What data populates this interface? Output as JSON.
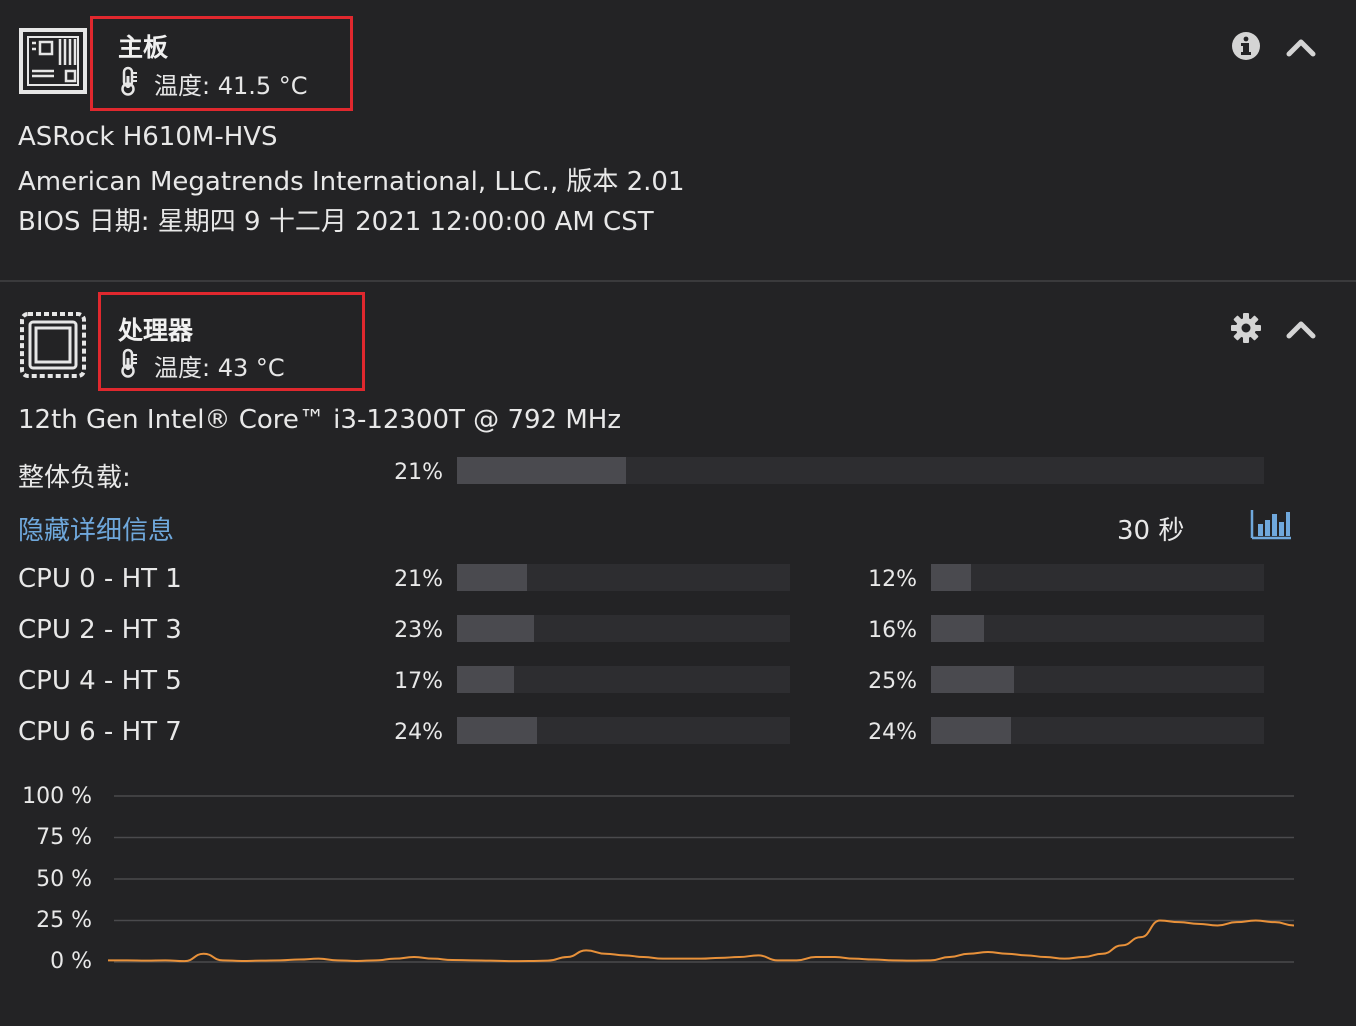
{
  "motherboard": {
    "title": "主板",
    "temperature": "温度: 41.5 °C",
    "model": "ASRock H610M-HVS",
    "vendor_line": "American Megatrends International, LLC., 版本 2.01",
    "bios_line": "BIOS 日期: 星期四 9 十二月 2021 12:00:00 AM CST",
    "icons": {
      "component": "motherboard-icon",
      "temp": "thermometer-icon",
      "info": "info-icon",
      "collapse": "chevron-up-icon"
    }
  },
  "processor": {
    "title": "处理器",
    "temperature": "温度: 43 °C",
    "model": "12th Gen Intel® Core™ i3-12300T @ 792 MHz",
    "overall": {
      "label": "整体负载:",
      "pct_text": "21%",
      "value": 21
    },
    "toggle_details_label": "隐藏详细信息",
    "interval_label": "30 秒",
    "cores": [
      {
        "label": "CPU 0 - HT 1",
        "a_text": "21%",
        "a": 21,
        "b_text": "12%",
        "b": 12
      },
      {
        "label": "CPU 2 - HT 3",
        "a_text": "23%",
        "a": 23,
        "b_text": "16%",
        "b": 16
      },
      {
        "label": "CPU 4 - HT 5",
        "a_text": "17%",
        "a": 17,
        "b_text": "25%",
        "b": 25
      },
      {
        "label": "CPU 6 - HT 7",
        "a_text": "24%",
        "a": 24,
        "b_text": "24%",
        "b": 24
      }
    ],
    "icons": {
      "component": "cpu-chip-icon",
      "temp": "thermometer-icon",
      "settings": "gear-icon",
      "collapse": "chevron-up-icon",
      "chart_toggle": "bar-chart-icon"
    },
    "colors": {
      "accent_link": "#6fa8dc",
      "highlight_box": "#e0282e",
      "series_line": "#e8913a",
      "bar_fill": "#4a4a4f",
      "bar_track": "#2d2d30"
    }
  },
  "chart_data": {
    "type": "line",
    "ytick_labels": [
      "100 %",
      "75 %",
      "50 %",
      "25 %",
      "0 %"
    ],
    "ylim": [
      0,
      100
    ],
    "grid": true,
    "series": [
      {
        "values": [
          1,
          1,
          0.8,
          1,
          0.5,
          5,
          1,
          0.6,
          0.8,
          1,
          1.5,
          2,
          1,
          0.6,
          1,
          2,
          3,
          2,
          1.2,
          1,
          0.8,
          0.5,
          0.6,
          0.8,
          3,
          7,
          5,
          4,
          3,
          2,
          2,
          2,
          2.5,
          3,
          4,
          1,
          1,
          3,
          3,
          2,
          1.5,
          1,
          0.8,
          1,
          3,
          5,
          6,
          5,
          4,
          3,
          2,
          3,
          5,
          10,
          15,
          25,
          24,
          23,
          22,
          24,
          25,
          24,
          22
        ]
      }
    ]
  }
}
